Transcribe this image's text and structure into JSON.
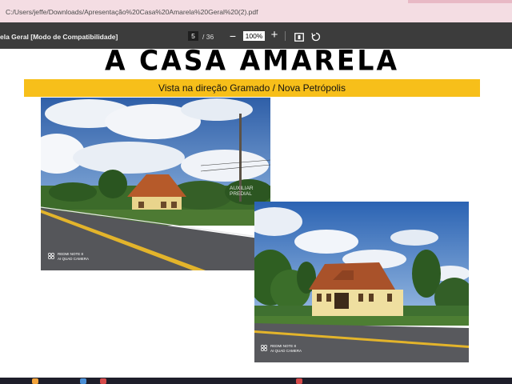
{
  "browser": {
    "address_bar": "C:/Users/jeffe/Downloads/Apresentação%20Casa%20Amarela%20Geral%20(2).pdf"
  },
  "pdf_toolbar": {
    "document_title": "ela Geral [Modo de Compatibilidade]",
    "page_current": "5",
    "page_total": "/ 36",
    "zoom_value": "100%",
    "zoom_out_label": "−",
    "zoom_in_label": "+"
  },
  "slide": {
    "heading": "A CASA AMARELA",
    "banner_text": "Vista na direção Gramado / Nova Petrópolis",
    "banner_color": "#f7bf1a",
    "photo1": {
      "watermark_line1": "AUXILIAR",
      "watermark_line2": "PREDIAL",
      "stamp_line1": "REDMI NOTE 8",
      "stamp_line2": "AI QUAD CAMERA"
    },
    "photo2": {
      "stamp_line1": "REDMI NOTE 8",
      "stamp_line2": "AI QUAD CAMERA"
    }
  },
  "icons": [
    "fit-page-icon",
    "rotate-icon",
    "camera-stamp-icon"
  ]
}
